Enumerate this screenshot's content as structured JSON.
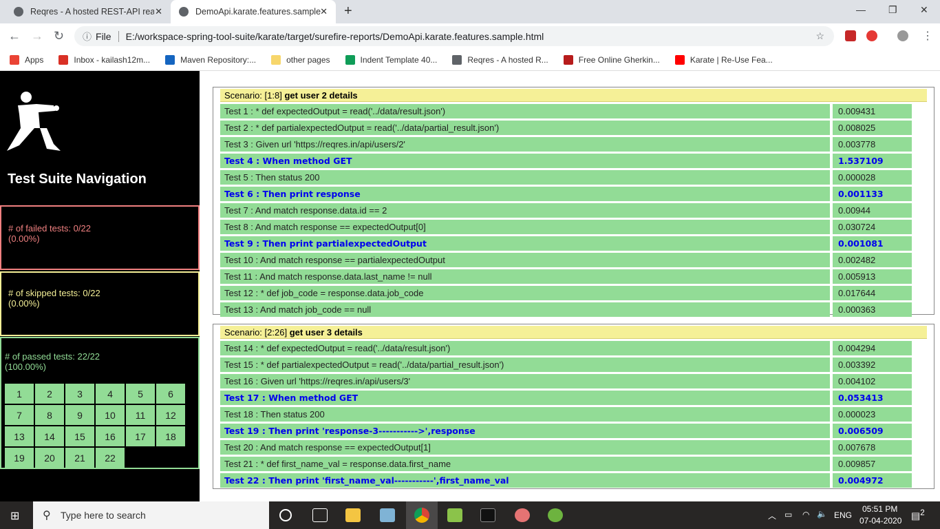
{
  "browser": {
    "tabs": [
      {
        "title": "Reqres - A hosted REST-API ready"
      },
      {
        "title": "DemoApi.karate.features.sample"
      }
    ],
    "address": {
      "scheme_label": "File",
      "url": "E:/workspace-spring-tool-suite/karate/target/surefire-reports/DemoApi.karate.features.sample.html"
    },
    "bookmarks": [
      {
        "label": "Apps",
        "color": "#ea4335"
      },
      {
        "label": "Inbox - kailash12m...",
        "color": "#d93025"
      },
      {
        "label": "Maven Repository:...",
        "color": "#1565c0"
      },
      {
        "label": "other pages",
        "color": "#f7d66b"
      },
      {
        "label": "Indent Template 40...",
        "color": "#0f9d58"
      },
      {
        "label": "Reqres - A hosted R...",
        "color": "#5f6368"
      },
      {
        "label": "Free Online Gherkin...",
        "color": "#b71c1c"
      },
      {
        "label": "Karate | Re-Use Fea...",
        "color": "#ff0000"
      }
    ]
  },
  "sidebar": {
    "title": "Test Suite Navigation",
    "failed": {
      "label": "# of failed tests: 0/22",
      "pct": "(0.00%)",
      "color": "#f08080"
    },
    "skipped": {
      "label": "# of skipped tests: 0/22",
      "pct": "(0.00%)",
      "color": "#f5f097"
    },
    "passed": {
      "label": "# of passed tests: 22/22",
      "pct": "(100.00%)",
      "color": "#92dc96"
    },
    "test_links": [
      "1",
      "2",
      "3",
      "4",
      "5",
      "6",
      "7",
      "8",
      "9",
      "10",
      "11",
      "12",
      "13",
      "14",
      "15",
      "16",
      "17",
      "18",
      "19",
      "20",
      "21",
      "22"
    ]
  },
  "scenarios": [
    {
      "prefix": "Scenario: [1:8]",
      "name": "get user 2 details",
      "tests": [
        {
          "desc": "Test 1 : * def expectedOutput = read('../data/result.json')",
          "time": "0.009431",
          "highlight": false
        },
        {
          "desc": "Test 2 : * def partialexpectedOutput = read('../data/partial_result.json')",
          "time": "0.008025",
          "highlight": false
        },
        {
          "desc": "Test 3 : Given url 'https://reqres.in/api/users/2'",
          "time": "0.003778",
          "highlight": false
        },
        {
          "desc": "Test 4 : When method GET",
          "time": "1.537109",
          "highlight": true
        },
        {
          "desc": "Test 5 : Then status 200",
          "time": "0.000028",
          "highlight": false
        },
        {
          "desc": "Test 6 : Then print response",
          "time": "0.001133",
          "highlight": true
        },
        {
          "desc": "Test 7 : And match response.data.id == 2",
          "time": "0.00944",
          "highlight": false
        },
        {
          "desc": "Test 8 : And match response == expectedOutput[0]",
          "time": "0.030724",
          "highlight": false
        },
        {
          "desc": "Test 9 : Then print partialexpectedOutput",
          "time": "0.001081",
          "highlight": true
        },
        {
          "desc": "Test 10 : And match response == partialexpectedOutput",
          "time": "0.002482",
          "highlight": false
        },
        {
          "desc": "Test 11 : And match response.data.last_name != null",
          "time": "0.005913",
          "highlight": false
        },
        {
          "desc": "Test 12 : * def job_code = response.data.job_code",
          "time": "0.017644",
          "highlight": false
        },
        {
          "desc": "Test 13 : And match job_code == null",
          "time": "0.000363",
          "highlight": false
        }
      ]
    },
    {
      "prefix": "Scenario: [2:26]",
      "name": "get user 3 details",
      "tests": [
        {
          "desc": "Test 14 : * def expectedOutput = read('../data/result.json')",
          "time": "0.004294",
          "highlight": false
        },
        {
          "desc": "Test 15 : * def partialexpectedOutput = read('../data/partial_result.json')",
          "time": "0.003392",
          "highlight": false
        },
        {
          "desc": "Test 16 : Given url 'https://reqres.in/api/users/3'",
          "time": "0.004102",
          "highlight": false
        },
        {
          "desc": "Test 17 : When method GET",
          "time": "0.053413",
          "highlight": true
        },
        {
          "desc": "Test 18 : Then status 200",
          "time": "0.000023",
          "highlight": false
        },
        {
          "desc": "Test 19 : Then print 'response-3----------->',response",
          "time": "0.006509",
          "highlight": true
        },
        {
          "desc": "Test 20 : And match response == expectedOutput[1]",
          "time": "0.007678",
          "highlight": false
        },
        {
          "desc": "Test 21 : * def first_name_val = response.data.first_name",
          "time": "0.009857",
          "highlight": false
        },
        {
          "desc": "Test 22 : Then print 'first_name_val-----------',first_name_val",
          "time": "0.004972",
          "highlight": true
        }
      ]
    }
  ],
  "taskbar": {
    "search_placeholder": "Type here to search",
    "language": "ENG",
    "time": "05:51 PM",
    "date": "07-04-2020",
    "notifications": "2"
  }
}
